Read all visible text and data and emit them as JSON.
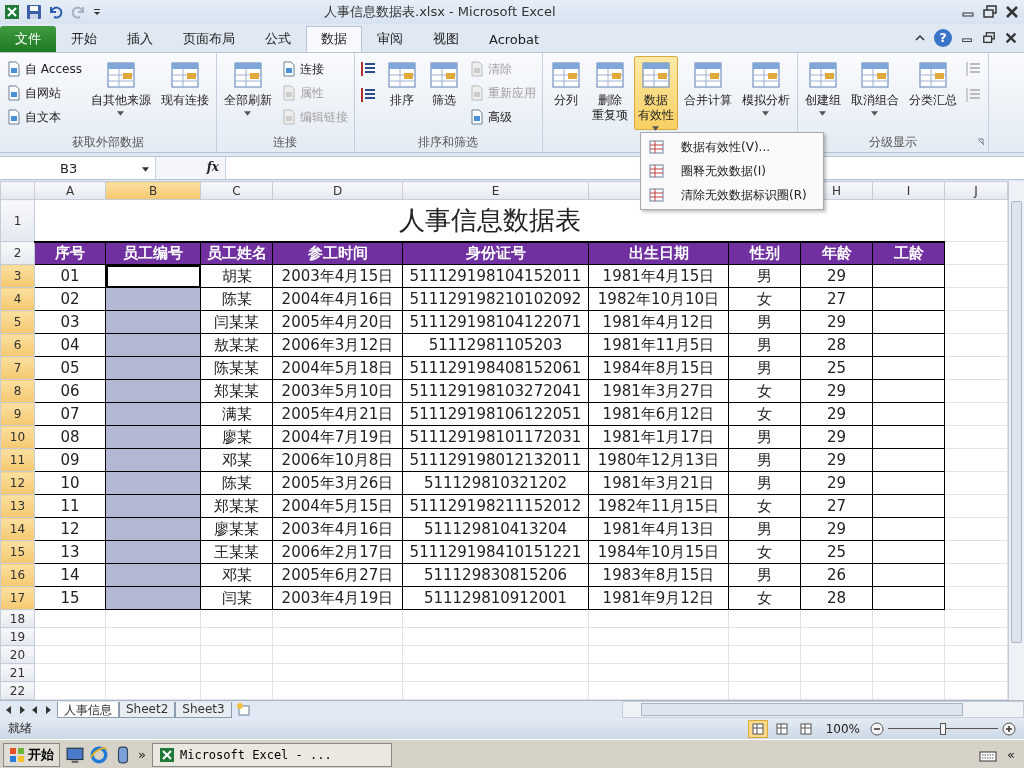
{
  "window": {
    "title": "人事信息数据表.xlsx  -  Microsoft Excel"
  },
  "tabs": [
    {
      "label": "文件",
      "kind": "file",
      "selected": false
    },
    {
      "label": "开始",
      "kind": "tab",
      "selected": false
    },
    {
      "label": "插入",
      "kind": "tab",
      "selected": false
    },
    {
      "label": "页面布局",
      "kind": "tab",
      "selected": false
    },
    {
      "label": "公式",
      "kind": "tab",
      "selected": false
    },
    {
      "label": "数据",
      "kind": "tab",
      "selected": true
    },
    {
      "label": "审阅",
      "kind": "tab",
      "selected": false
    },
    {
      "label": "视图",
      "kind": "tab",
      "selected": false
    },
    {
      "label": "Acrobat",
      "kind": "tab",
      "selected": false
    }
  ],
  "help": "?",
  "ribbon": {
    "groups": [
      {
        "label": "获取外部数据",
        "items": [
          {
            "kind": "stack",
            "buttons": [
              {
                "label": "自 Access",
                "disabled": false
              },
              {
                "label": "自网站",
                "disabled": false
              },
              {
                "label": "自文本",
                "disabled": false
              }
            ]
          },
          {
            "kind": "large",
            "label": "自其他来源",
            "dropdown": true,
            "selected": false
          },
          {
            "kind": "large",
            "label": "现有连接",
            "selected": false
          }
        ]
      },
      {
        "label": "连接",
        "items": [
          {
            "kind": "large",
            "label": "全部刷新",
            "dropdown": true,
            "selected": false
          },
          {
            "kind": "stack",
            "buttons": [
              {
                "label": "连接",
                "disabled": false
              },
              {
                "label": "属性",
                "disabled": true
              },
              {
                "label": "编辑链接",
                "disabled": true
              }
            ]
          }
        ]
      },
      {
        "label": "排序和筛选",
        "items": [
          {
            "kind": "icons",
            "buttons": [
              {
                "disabled": false
              },
              {
                "disabled": false
              }
            ]
          },
          {
            "kind": "large",
            "label": "排序",
            "selected": false
          },
          {
            "kind": "large",
            "label": "筛选",
            "selected": false
          },
          {
            "kind": "stack",
            "buttons": [
              {
                "label": "清除",
                "disabled": true
              },
              {
                "label": "重新应用",
                "disabled": true
              },
              {
                "label": "高级",
                "disabled": false
              }
            ]
          }
        ]
      },
      {
        "items": [
          {
            "kind": "large",
            "label": "分列",
            "selected": false
          },
          {
            "kind": "large",
            "lines": [
              "删除",
              "重复项"
            ],
            "selected": false
          },
          {
            "kind": "large",
            "lines": [
              "数据",
              "有效性"
            ],
            "dropdown": true,
            "selected": true
          },
          {
            "kind": "large",
            "label": "合并计算",
            "selected": false
          },
          {
            "kind": "large",
            "label": "模拟分析",
            "dropdown": true,
            "selected": false
          }
        ]
      },
      {
        "label": "分级显示",
        "launcher": true,
        "items": [
          {
            "kind": "large",
            "label": "创建组",
            "dropdown": true,
            "selected": false
          },
          {
            "kind": "large",
            "label": "取消组合",
            "dropdown": true,
            "selected": false
          },
          {
            "kind": "large",
            "label": "分类汇总",
            "selected": false
          },
          {
            "kind": "icons",
            "buttons": [
              {
                "disabled": true
              },
              {
                "disabled": true
              }
            ]
          }
        ]
      }
    ]
  },
  "menu": {
    "items": [
      {
        "label": "数据有效性(V)..."
      },
      {
        "label": "圈释无效数据(I)"
      },
      {
        "label": "清除无效数据标识圈(R)"
      }
    ]
  },
  "formula_bar": {
    "name_box": "B3",
    "function_label": "fx"
  },
  "sheet": {
    "columns": [
      {
        "label": "A",
        "selected": false
      },
      {
        "label": "B",
        "selected": true
      },
      {
        "label": "C",
        "selected": false
      },
      {
        "label": "D",
        "selected": false
      },
      {
        "label": "E",
        "selected": false
      },
      {},
      {},
      {
        "label": "H",
        "selected": false
      },
      {
        "label": "I",
        "selected": false
      },
      {
        "label": "J",
        "selected": false
      }
    ],
    "title_row": "1",
    "title": "人事信息数据表",
    "header_row": "2",
    "headers": [
      "序号",
      "员工编号",
      "员工姓名",
      "参工时间",
      "身份证号",
      "出生日期",
      "性别",
      "年龄",
      "工龄"
    ],
    "rows": [
      {
        "row": "3",
        "number": "01",
        "employee_id": {
          "selected": true,
          "active": true
        },
        "name": "胡某",
        "join_date": "2003年4月15日",
        "id_card": "511129198104152011",
        "birth_date": "1981年4月15日",
        "gender": "男",
        "age": "29"
      },
      {
        "row": "4",
        "number": "02",
        "employee_id": {
          "selected": true,
          "active": false
        },
        "name": "陈某",
        "join_date": "2004年4月16日",
        "id_card": "511129198210102092",
        "birth_date": "1982年10月10日",
        "gender": "女",
        "age": "27"
      },
      {
        "row": "5",
        "number": "03",
        "employee_id": {
          "selected": true,
          "active": false
        },
        "name": "闫某某",
        "join_date": "2005年4月20日",
        "id_card": "511129198104122071",
        "birth_date": "1981年4月12日",
        "gender": "男",
        "age": "29"
      },
      {
        "row": "6",
        "number": "04",
        "employee_id": {
          "selected": true,
          "active": false
        },
        "name": "敖某某",
        "join_date": "2006年3月12日",
        "id_card": "51112981105203",
        "birth_date": "1981年11月5日",
        "gender": "男",
        "age": "28"
      },
      {
        "row": "7",
        "number": "05",
        "employee_id": {
          "selected": true,
          "active": false
        },
        "name": "陈某某",
        "join_date": "2004年5月18日",
        "id_card": "511129198408152061",
        "birth_date": "1984年8月15日",
        "gender": "男",
        "age": "25"
      },
      {
        "row": "8",
        "number": "06",
        "employee_id": {
          "selected": true,
          "active": false
        },
        "name": "郑某某",
        "join_date": "2003年5月10日",
        "id_card": "511129198103272041",
        "birth_date": "1981年3月27日",
        "gender": "女",
        "age": "29"
      },
      {
        "row": "9",
        "number": "07",
        "employee_id": {
          "selected": true,
          "active": false
        },
        "name": "满某",
        "join_date": "2005年4月21日",
        "id_card": "511129198106122051",
        "birth_date": "1981年6月12日",
        "gender": "女",
        "age": "29"
      },
      {
        "row": "10",
        "number": "08",
        "employee_id": {
          "selected": true,
          "active": false
        },
        "name": "廖某",
        "join_date": "2004年7月19日",
        "id_card": "511129198101172031",
        "birth_date": "1981年1月17日",
        "gender": "男",
        "age": "29"
      },
      {
        "row": "11",
        "number": "09",
        "employee_id": {
          "selected": true,
          "active": false
        },
        "name": "邓某",
        "join_date": "2006年10月8日",
        "id_card": "511129198012132011",
        "birth_date": "1980年12月13日",
        "gender": "男",
        "age": "29"
      },
      {
        "row": "12",
        "number": "10",
        "employee_id": {
          "selected": true,
          "active": false
        },
        "name": "陈某",
        "join_date": "2005年3月26日",
        "id_card": "511129810321202",
        "birth_date": "1981年3月21日",
        "gender": "男",
        "age": "29"
      },
      {
        "row": "13",
        "number": "11",
        "employee_id": {
          "selected": true,
          "active": false
        },
        "name": "郑某某",
        "join_date": "2004年5月15日",
        "id_card": "511129198211152012",
        "birth_date": "1982年11月15日",
        "gender": "女",
        "age": "27"
      },
      {
        "row": "14",
        "number": "12",
        "employee_id": {
          "selected": true,
          "active": false
        },
        "name": "廖某某",
        "join_date": "2003年4月16日",
        "id_card": "511129810413204",
        "birth_date": "1981年4月13日",
        "gender": "男",
        "age": "29"
      },
      {
        "row": "15",
        "number": "13",
        "employee_id": {
          "selected": true,
          "active": false
        },
        "name": "王某某",
        "join_date": "2006年2月17日",
        "id_card": "511129198410151221",
        "birth_date": "1984年10月15日",
        "gender": "女",
        "age": "25"
      },
      {
        "row": "16",
        "number": "14",
        "employee_id": {
          "selected": true,
          "active": false
        },
        "name": "邓某",
        "join_date": "2005年6月27日",
        "id_card": "511129830815206",
        "birth_date": "1983年8月15日",
        "gender": "男",
        "age": "26"
      },
      {
        "row": "17",
        "number": "15",
        "employee_id": {
          "selected": true,
          "active": false
        },
        "name": "闫某",
        "join_date": "2003年4月19日",
        "id_card": "511129810912001",
        "birth_date": "1981年9月12日",
        "gender": "女",
        "age": "28"
      }
    ],
    "empty_rows": [
      "18",
      "19",
      "20",
      "21",
      "22"
    ]
  },
  "sheet_tabs": [
    {
      "label": "人事信息",
      "selected": true
    },
    {
      "label": "Sheet2",
      "selected": false
    },
    {
      "label": "Sheet3",
      "selected": false
    }
  ],
  "status_bar": {
    "status": "就绪",
    "views": [
      {
        "selected": true
      },
      {
        "selected": false
      },
      {
        "selected": false
      }
    ],
    "zoom": "100%",
    "zoom_level": {
      "level": 0.5
    }
  },
  "taskbar": {
    "start": "开始",
    "more": "»",
    "task": "Microsoft Excel - ...",
    "tray_toggle": "«"
  }
}
